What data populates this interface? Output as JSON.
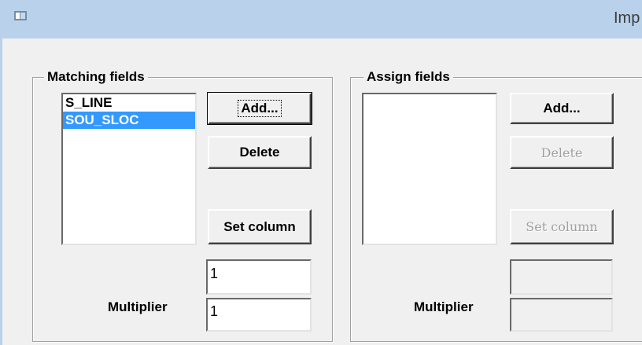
{
  "window": {
    "title": "Imp",
    "title_bar_color": "#b9d1ea"
  },
  "matching": {
    "caption": "Matching fields",
    "list_items": [
      "S_LINE",
      "SOU_SLOC"
    ],
    "selected_item": "SOU_SLOC",
    "add_label": "Add...",
    "delete_label": "Delete",
    "set_column_label": "Set column",
    "value_input": "1",
    "multiplier_label": "Multiplier",
    "multiplier_value": "1"
  },
  "assign": {
    "caption": "Assign fields",
    "list_items": [],
    "add_label": "Add...",
    "delete_label": "Delete",
    "set_column_label": "Set column",
    "value_input": "",
    "multiplier_label": "Multiplier",
    "multiplier_value": ""
  },
  "colors": {
    "selection": "#3399ff",
    "disabled_text": "#a0a0a0"
  }
}
